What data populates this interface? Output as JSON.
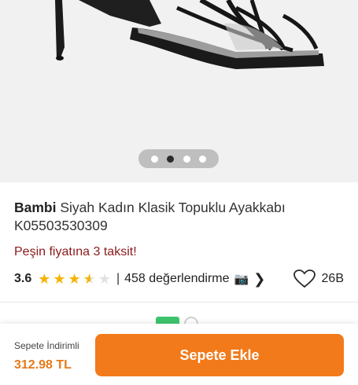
{
  "gallery": {
    "image_alt": "Black strappy heeled sandal",
    "slide_count": 4,
    "active_slide": 2
  },
  "product": {
    "brand": "Bambi",
    "name": " Siyah Kadın Klasik Topuklu Ayakkabı K05503530309",
    "promo": "Peşin fiyatına 3 taksit!"
  },
  "rating": {
    "score": "3.6",
    "score_value": 3.6,
    "separator": "|",
    "reviews": "458 değerlendirme",
    "camera_icon": "📷",
    "chevron_icon": "❯"
  },
  "favorite": {
    "count": "26B",
    "icon": "heart-outline-icon"
  },
  "bottom": {
    "price_label": "Sepete İndirimli",
    "price": "312.98 TL",
    "cart_button": "Sepete Ekle"
  },
  "colors": {
    "accent": "#f27a1a",
    "promo": "#8b1a1a",
    "star": "#f5b301",
    "price": "#e57a1b"
  }
}
